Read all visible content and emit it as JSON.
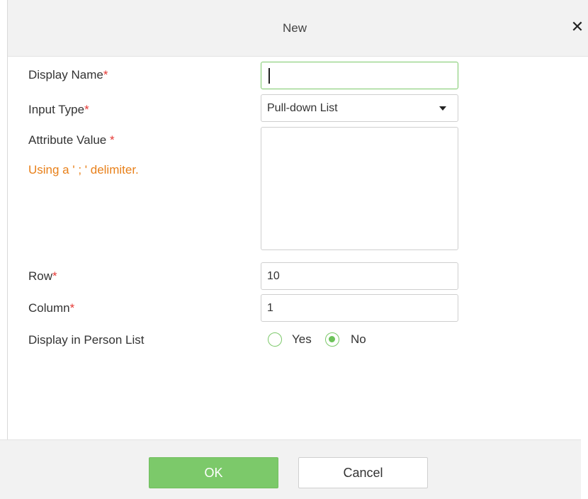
{
  "dialog": {
    "title": "New",
    "close_glyph": "✕"
  },
  "form": {
    "display_name": {
      "label": "Display Name",
      "required_mark": "*",
      "value": ""
    },
    "input_type": {
      "label": "Input Type",
      "required_mark": "*",
      "selected": "Pull-down List"
    },
    "attribute_value": {
      "label": "Attribute Value ",
      "required_mark": "*",
      "hint": "Using a ' ; ' delimiter.",
      "value": ""
    },
    "row": {
      "label": "Row",
      "required_mark": "*",
      "value": "10"
    },
    "column": {
      "label": "Column",
      "required_mark": "*",
      "value": "1"
    },
    "display_in_person_list": {
      "label": "Display in Person List",
      "options": [
        {
          "label": "Yes",
          "selected": false
        },
        {
          "label": "No",
          "selected": true
        }
      ]
    }
  },
  "buttons": {
    "ok": "OK",
    "cancel": "Cancel"
  },
  "colors": {
    "accent": "#7cc96a",
    "required": "#e53935",
    "hint": "#e8801a",
    "header_bg": "#f2f2f2"
  },
  "icons": {
    "close": "close-icon",
    "dropdown": "chevron-down-icon"
  }
}
